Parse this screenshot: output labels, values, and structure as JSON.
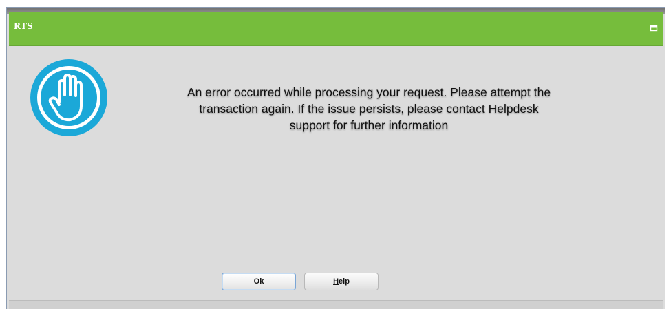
{
  "dialog": {
    "title": "RTS",
    "icon": "stop-hand-icon",
    "message_lines": [
      "An error occurred while processing your request. Please attempt the",
      "transaction again. If the issue persists, please contact Helpdesk",
      "support for further information"
    ],
    "buttons": {
      "ok_label": "Ok",
      "help_mnemonic": "H",
      "help_rest": "elp"
    }
  },
  "colors": {
    "titlebar": "#76bd3c",
    "icon": "#1ba8d8",
    "background": "#dcdcdc"
  }
}
